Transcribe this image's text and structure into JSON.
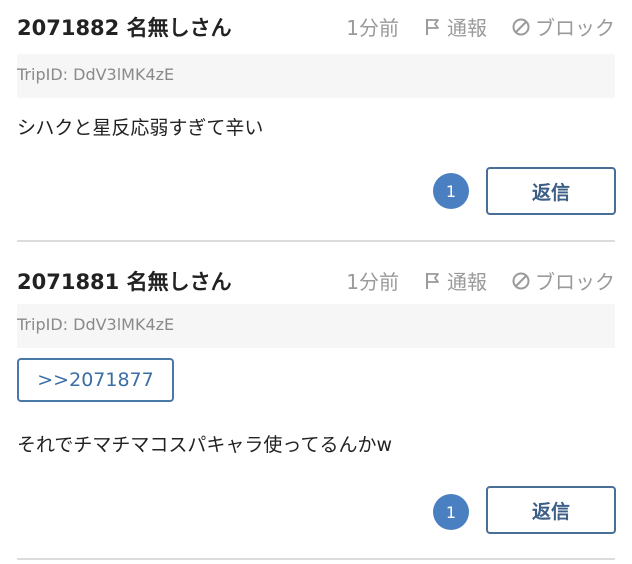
{
  "posts": [
    {
      "number": "2071882",
      "name": "名無しさん",
      "time": "1分前",
      "report_label": "通報",
      "block_label": "ブロック",
      "trip": "TripID: DdV3lMK4zE",
      "body": "シハクと星反応弱すぎて辛い",
      "reply_count": "1",
      "reply_label": "返信"
    },
    {
      "number": "2071881",
      "name": "名無しさん",
      "time": "1分前",
      "report_label": "通報",
      "block_label": "ブロック",
      "trip": "TripID: DdV3lMK4zE",
      "anchor": ">>2071877",
      "body": "それでチマチマコスパキャラ使ってるんかw",
      "reply_count": "1",
      "reply_label": "返信"
    }
  ],
  "icons": {
    "report": "flag-icon",
    "block": "block-icon"
  },
  "colors": {
    "accent": "#4a7fc1",
    "button_border": "#4a6f96",
    "meta_text": "#9a9a9a",
    "trip_bg": "#f6f6f6"
  }
}
